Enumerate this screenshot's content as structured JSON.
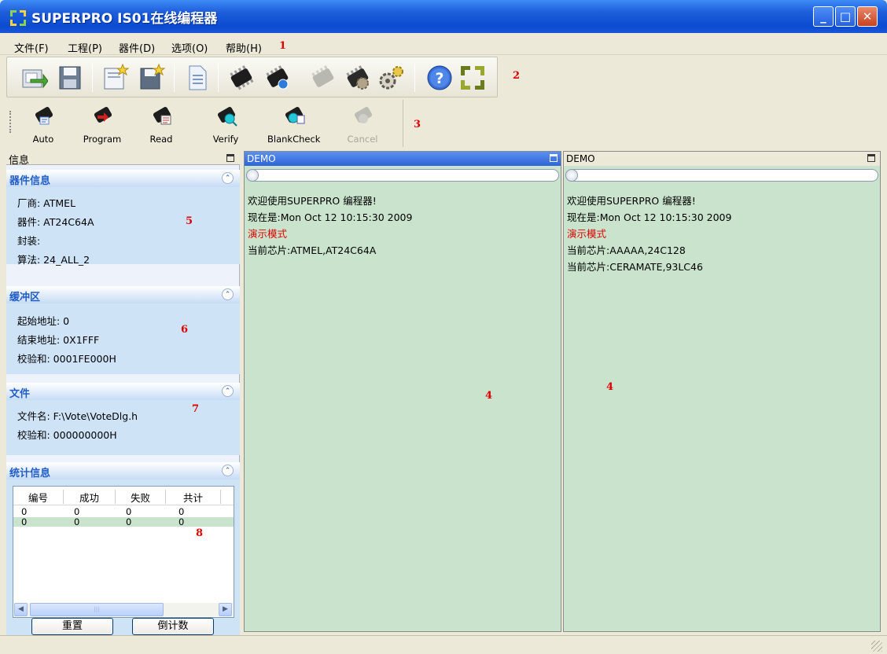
{
  "window": {
    "title": "SUPERPRO IS01在线编程器",
    "controls": {
      "minimize": "_",
      "maximize": "□",
      "close": "✕"
    }
  },
  "menu": {
    "items": [
      "文件(F)",
      "工程(P)",
      "器件(D)",
      "选项(O)",
      "帮助(H)"
    ]
  },
  "annotations": {
    "menu": "1",
    "toolbar": "2",
    "action_bar": "3",
    "pane_left": "4",
    "pane_right": "4",
    "device": "5",
    "buffer": "6",
    "file": "7",
    "stats": "8"
  },
  "toolbar": {
    "icons": [
      "open-icon",
      "save-icon",
      "new-project-icon",
      "save-project-icon",
      "document-icon",
      "chip-icon",
      "chip-info-icon",
      "chip-disabled-icon",
      "chip-gear-icon",
      "chip-settings-icon",
      "help-icon",
      "logo-icon"
    ]
  },
  "action_bar": {
    "buttons": [
      {
        "label": "Auto",
        "enabled": true
      },
      {
        "label": "Program",
        "enabled": true
      },
      {
        "label": "Read",
        "enabled": true
      },
      {
        "label": "Verify",
        "enabled": true
      },
      {
        "label": "BlankCheck",
        "enabled": true
      },
      {
        "label": "Cancel",
        "enabled": false
      }
    ]
  },
  "info_panel": {
    "header": "信息",
    "device": {
      "title": "器件信息",
      "vendor": "厂商: ATMEL",
      "part": "器件: AT24C64A",
      "package": "封装:",
      "algorithm": "算法: 24_ALL_2"
    },
    "buffer": {
      "title": "缓冲区",
      "start": "起始地址: 0",
      "end": "结束地址: 0X1FFF",
      "checksum": "校验和: 0001FE000H"
    },
    "file": {
      "title": "文件",
      "name": "文件名: F:\\Vote\\VoteDlg.h",
      "checksum": "校验和: 000000000H"
    },
    "stats": {
      "title": "统计信息",
      "columns": [
        "编号",
        "成功",
        "失败",
        "共计"
      ],
      "rows": [
        [
          "0",
          "0",
          "0",
          "0"
        ],
        [
          "0",
          "0",
          "0",
          "0"
        ]
      ],
      "reset_button": "重置",
      "countdown_button": "倒计数"
    }
  },
  "panes": [
    {
      "title": "DEMO",
      "active": true,
      "lines": [
        {
          "text": "欢迎使用SUPERPRO 编程器!",
          "color": "#000000"
        },
        {
          "text": "现在是:Mon Oct 12 10:15:30 2009",
          "color": "#000000"
        },
        {
          "text": "演示模式",
          "color": "#e00000"
        },
        {
          "text": "当前芯片:ATMEL,AT24C64A",
          "color": "#000000"
        }
      ]
    },
    {
      "title": "DEMO",
      "active": false,
      "lines": [
        {
          "text": "欢迎使用SUPERPRO 编程器!",
          "color": "#000000"
        },
        {
          "text": "现在是:Mon Oct 12 10:15:30 2009",
          "color": "#000000"
        },
        {
          "text": "演示模式",
          "color": "#e00000"
        },
        {
          "text": "当前芯片:AAAAA,24C128",
          "color": "#000000"
        },
        {
          "text": "当前芯片:CERAMATE,93LC46",
          "color": "#000000"
        }
      ]
    }
  ],
  "colors": {
    "title_bar": "#0a4bd0",
    "pane_bg": "#c9e3cc",
    "section_title": "#215dc6",
    "annotation": "#dd0000"
  }
}
